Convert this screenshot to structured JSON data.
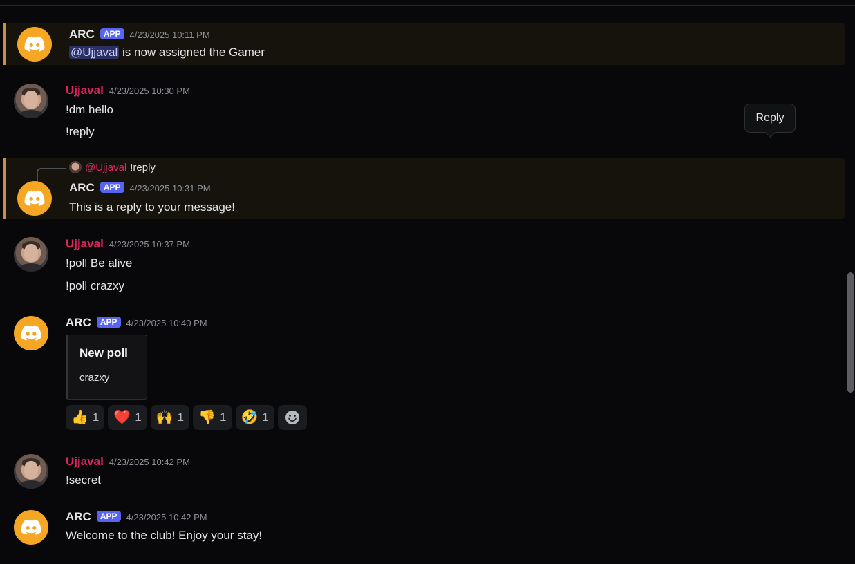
{
  "colors": {
    "background": "#08080a",
    "highlight_bg": "#16130c",
    "highlight_border": "#c7914c",
    "bot_avatar": "#f5a623",
    "user_name": "#e0245e",
    "app_badge": "#5865f2"
  },
  "tooltip": {
    "label": "Reply"
  },
  "messages": [
    {
      "author": "ARC",
      "badge": "APP",
      "timestamp": "4/23/2025 10:11 PM",
      "avatar_icon": "discord-logo-icon",
      "mention": "@Ujjaval",
      "text_after_mention": " is now assigned the Gamer"
    },
    {
      "author": "Ujjaval",
      "timestamp": "4/23/2025 10:30 PM",
      "lines": [
        "!dm hello",
        "!reply"
      ]
    },
    {
      "author": "ARC",
      "badge": "APP",
      "timestamp": "4/23/2025 10:31 PM",
      "avatar_icon": "discord-logo-icon",
      "reply_to": {
        "author": "@Ujjaval",
        "text": "!reply"
      },
      "lines": [
        "This is a reply to your message!"
      ]
    },
    {
      "author": "Ujjaval",
      "timestamp": "4/23/2025 10:37 PM",
      "lines": [
        "!poll Be alive",
        "!poll crazxy"
      ]
    },
    {
      "author": "ARC",
      "badge": "APP",
      "timestamp": "4/23/2025 10:40 PM",
      "avatar_icon": "discord-logo-icon",
      "embed": {
        "title": "New poll",
        "description": "crazxy"
      },
      "reactions": [
        {
          "emoji": "👍",
          "icon": "thumbs-up-icon",
          "count": "1"
        },
        {
          "emoji": "❤️",
          "icon": "red-heart-icon",
          "count": "1"
        },
        {
          "emoji": "🙌",
          "icon": "raising-hands-icon",
          "count": "1"
        },
        {
          "emoji": "👎",
          "icon": "thumbs-down-icon",
          "count": "1"
        },
        {
          "emoji": "🤣",
          "icon": "rolling-laughing-icon",
          "count": "1"
        }
      ],
      "add_reaction_icon": "add-reaction-icon"
    },
    {
      "author": "Ujjaval",
      "timestamp": "4/23/2025 10:42 PM",
      "lines": [
        "!secret"
      ]
    },
    {
      "author": "ARC",
      "badge": "APP",
      "timestamp": "4/23/2025 10:42 PM",
      "avatar_icon": "discord-logo-icon",
      "lines": [
        "Welcome to the club! Enjoy your stay!"
      ]
    }
  ]
}
